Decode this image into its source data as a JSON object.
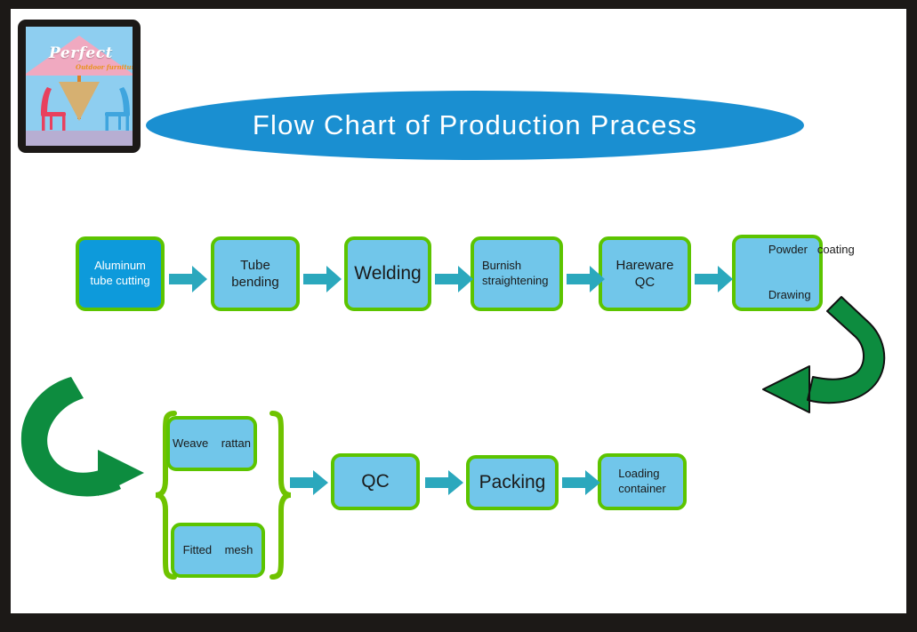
{
  "page": {
    "frame_color": "#1c1917",
    "canvas_color": "#ffffff"
  },
  "logo": {
    "brand": "Perfect",
    "tagline": "Outdoor furniture",
    "colors": {
      "sky": "#8ecef0",
      "umbrella": "#f0a9c0",
      "floor": "#b7aed2",
      "basket": "#d6b071",
      "pole": "#d9802a",
      "chair_left": "#e8415e",
      "chair_right": "#3fa5de",
      "brand_text": "#ffffff",
      "tagline_text": "#e8931e"
    }
  },
  "title": {
    "text": "Flow Chart of Production Pracess",
    "ellipse_color": "#1a8fd1",
    "text_color": "#ffffff"
  },
  "theme": {
    "box_fill": "#71c6ea",
    "box_fill_accent": "#0d9adb",
    "box_border": "#5cc400",
    "arrow_teal": "#2ba8bd",
    "arrow_green": "#0d8c3f",
    "brace_green": "#6fc300",
    "text_dark": "#1a1a1a",
    "text_light": "#ffffff"
  },
  "chart_data": {
    "type": "diagram",
    "title": "Flow Chart of Production Pracess",
    "rows": [
      {
        "id": "row-1",
        "nodes": [
          {
            "id": "n1",
            "label": "Aluminum tube cutting",
            "lines": [
              "Aluminum",
              "tube cutting"
            ],
            "style": "accent",
            "font": "small"
          },
          {
            "id": "n2",
            "label": "Tube bending",
            "lines": [
              "Tube bending"
            ],
            "style": "normal",
            "font": "mid"
          },
          {
            "id": "n3",
            "label": "Welding",
            "lines": [
              "Welding"
            ],
            "style": "normal",
            "font": "large"
          },
          {
            "id": "n4",
            "label": "Burnish straightening",
            "lines": [
              "Burnish",
              "straightening"
            ],
            "style": "normal",
            "font": "small"
          },
          {
            "id": "n5",
            "label": "Hareware QC",
            "lines": [
              "Hareware QC"
            ],
            "style": "normal",
            "font": "mid"
          },
          {
            "id": "n6",
            "label": "Powder coating Drawing",
            "lines": [
              "Powder   coating",
              "",
              "Drawing"
            ],
            "style": "normal",
            "font": "small"
          }
        ]
      },
      {
        "id": "row-2",
        "nodes": [
          {
            "id": "n7",
            "label": "Weave rattan",
            "lines": [
              "Weave    rattan"
            ],
            "style": "normal",
            "font": "small"
          },
          {
            "id": "n8",
            "label": "Fitted mesh",
            "lines": [
              "Fitted    mesh"
            ],
            "style": "normal",
            "font": "small"
          },
          {
            "id": "n9",
            "label": "QC",
            "lines": [
              "QC"
            ],
            "style": "normal",
            "font": "large"
          },
          {
            "id": "n10",
            "label": "Packing",
            "lines": [
              "Packing"
            ],
            "style": "normal",
            "font": "large"
          },
          {
            "id": "n11",
            "label": "Loading container",
            "lines": [
              "Loading",
              "container"
            ],
            "style": "normal",
            "font": "small"
          }
        ]
      }
    ],
    "connectors": [
      {
        "from": "n1",
        "to": "n2",
        "type": "teal-arrow-right"
      },
      {
        "from": "n2",
        "to": "n3",
        "type": "teal-arrow-right"
      },
      {
        "from": "n3",
        "to": "n4",
        "type": "teal-arrow-right"
      },
      {
        "from": "n4",
        "to": "n5",
        "type": "teal-arrow-right"
      },
      {
        "from": "n5",
        "to": "n6",
        "type": "teal-arrow-right"
      },
      {
        "from": "n6",
        "to": "group-brace",
        "type": "green-uturn-left"
      },
      {
        "from": "green-uturn-left",
        "to": "group-brace",
        "type": "green-uturn-right"
      },
      {
        "from": "group-brace",
        "to": "n9",
        "type": "teal-arrow-right"
      },
      {
        "from": "n9",
        "to": "n10",
        "type": "teal-arrow-right"
      },
      {
        "from": "n10",
        "to": "n11",
        "type": "teal-arrow-right"
      }
    ],
    "groups": [
      {
        "id": "group-brace",
        "members": [
          "n7",
          "n8"
        ],
        "style": "curly-brace-pair",
        "color": "#6fc300"
      }
    ]
  },
  "boxes": {
    "n1_l1": "Aluminum",
    "n1_l2": "tube cutting",
    "n2": "Tube bending",
    "n3": "Welding",
    "n4_l1": "Burnish",
    "n4_l2": "straightening",
    "n5": "Hareware QC",
    "n6_l1": "Powder   coating",
    "n6_l2": "Drawing",
    "n7": "Weave    rattan",
    "n8": "Fitted    mesh",
    "n9": "QC",
    "n10": "Packing",
    "n11_l1": "Loading",
    "n11_l2": "container"
  }
}
